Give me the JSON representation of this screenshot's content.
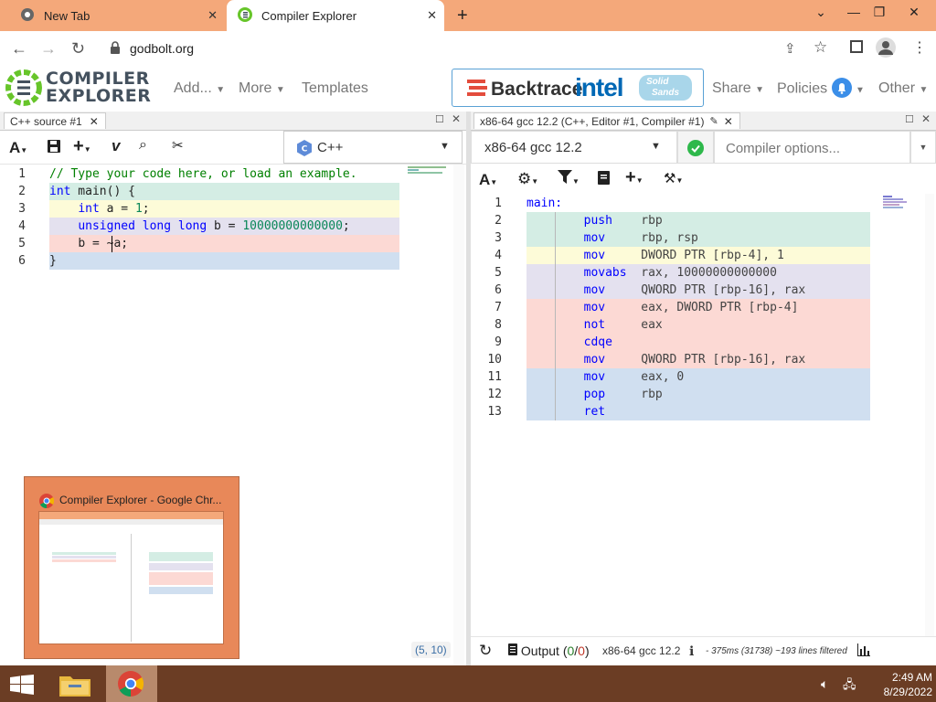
{
  "browser": {
    "tabs": [
      {
        "title": "New Tab",
        "active": false
      },
      {
        "title": "Compiler Explorer",
        "active": true
      }
    ],
    "url": "godbolt.org"
  },
  "site": {
    "logo_line1": "COMPILER",
    "logo_line2": "EXPLORER",
    "menu": {
      "add": "Add...",
      "more": "More",
      "templates": "Templates",
      "share": "Share",
      "policies": "Policies",
      "other": "Other"
    },
    "sponsors": {
      "backtrace": "Backtrace",
      "intel": "intel",
      "solid": "Solid",
      "sands": "Sands"
    }
  },
  "editor": {
    "tab_title": "C++ source #1",
    "language": "C++",
    "line_numbers": [
      "1",
      "2",
      "3",
      "4",
      "5",
      "6"
    ],
    "lines": {
      "l1": "// Type your code here, or load an example.",
      "l2_kw": "int",
      "l2_rest": " main() {",
      "l3_kw": "int",
      "l3_rest": " a = ",
      "l3_num": "1",
      "l3_end": ";",
      "l4_kw": "unsigned long long",
      "l4_rest": " b = ",
      "l4_num": "10000000000000",
      "l4_end": ";",
      "l5": "b = ~a;",
      "l6": "}"
    },
    "cursor_pos": "(5, 10)"
  },
  "compiler": {
    "tab_title": "x86-64 gcc 12.2 (C++, Editor #1, Compiler #1)",
    "name": "x86-64 gcc 12.2",
    "options_placeholder": "Compiler options...",
    "label": "main:",
    "line_numbers": [
      "1",
      "2",
      "3",
      "4",
      "5",
      "6",
      "7",
      "8",
      "9",
      "10",
      "11",
      "12",
      "13"
    ],
    "asm": [
      {
        "op": "push",
        "args": "rbp"
      },
      {
        "op": "mov",
        "args": "rbp, rsp"
      },
      {
        "op": "mov",
        "args": "DWORD PTR [rbp-4], 1"
      },
      {
        "op": "movabs",
        "args": "rax, 10000000000000"
      },
      {
        "op": "mov",
        "args": "QWORD PTR [rbp-16], rax"
      },
      {
        "op": "mov",
        "args": "eax, DWORD PTR [rbp-4]"
      },
      {
        "op": "not",
        "args": "eax"
      },
      {
        "op": "cdqe",
        "args": ""
      },
      {
        "op": "mov",
        "args": "QWORD PTR [rbp-16], rax"
      },
      {
        "op": "mov",
        "args": "eax, 0"
      },
      {
        "op": "pop",
        "args": "rbp"
      },
      {
        "op": "ret",
        "args": ""
      }
    ],
    "status": {
      "output_label": "Output",
      "output_count_open": "(",
      "output_count_a": "0",
      "output_count_sep": "/",
      "output_count_b": "0",
      "output_count_close": ")",
      "compiler_name": "x86-64 gcc 12.2",
      "timing": "- 375ms (31738) ~193 lines filtered"
    }
  },
  "thumbnail": {
    "title": "Compiler Explorer - Google Chr..."
  },
  "taskbar": {
    "time": "2:49 AM",
    "date": "8/29/2022"
  },
  "colors": {
    "tabstrip": "#f4a87a",
    "taskbar": "#6b3d24",
    "logo_green": "#67c52a",
    "logo_dark": "#44515e",
    "hl_green": "#d4ede4",
    "hl_yellow": "#fdfbd8",
    "hl_lavender": "#e4e1ef",
    "hl_red": "#fcd9d4",
    "hl_blue": "#d0dff0"
  }
}
